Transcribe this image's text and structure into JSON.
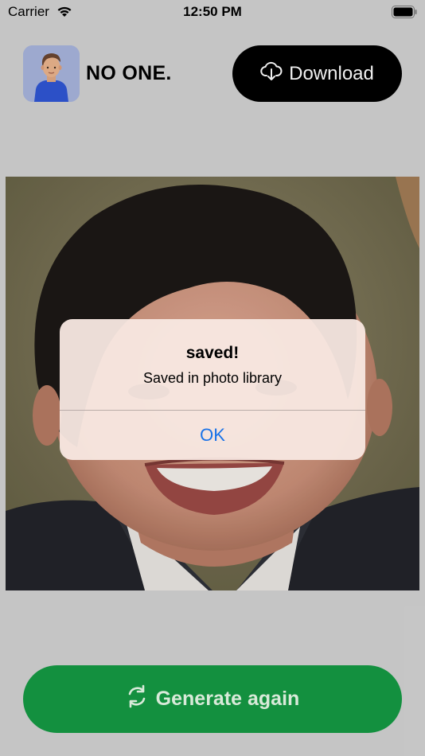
{
  "status_bar": {
    "carrier": "Carrier",
    "time": "12:50 PM"
  },
  "header": {
    "brand": "NO ONE.",
    "download_label": "Download"
  },
  "alert": {
    "title": "saved!",
    "message": "Saved in photo library",
    "ok_label": "OK"
  },
  "footer": {
    "generate_label": "Generate again"
  },
  "colors": {
    "background": "#d2d2d2",
    "download_button": "#000000",
    "generate_button": "#13903f",
    "alert_ok": "#1a73e8"
  },
  "icons": {
    "download": "cloud-download-icon",
    "generate": "refresh-icon",
    "avatar": "avatar-icon",
    "wifi": "wifi-icon",
    "battery": "battery-icon"
  }
}
